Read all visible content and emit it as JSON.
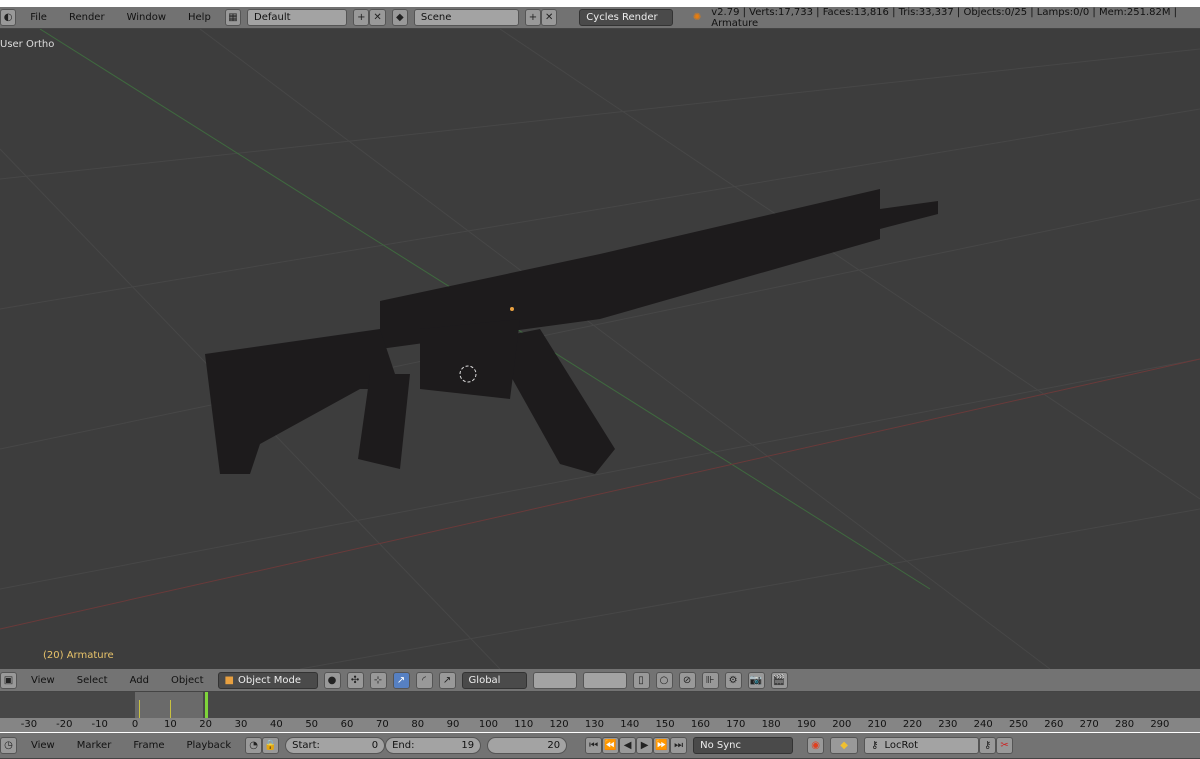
{
  "topbar": {
    "menus": [
      "File",
      "Render",
      "Window",
      "Help"
    ],
    "layout": "Default",
    "scene": "Scene",
    "engine": "Cycles Render",
    "stats": "v2.79 | Verts:17,733 | Faces:13,816 | Tris:33,337 | Objects:0/25 | Lamps:0/0 | Mem:251.82M | Armature"
  },
  "viewport": {
    "view_label": "User Ortho",
    "object_label": "(20) Armature"
  },
  "header3d": {
    "menus": [
      "View",
      "Select",
      "Add",
      "Object"
    ],
    "mode": "Object Mode",
    "orientation": "Global"
  },
  "timeline": {
    "ticks": [
      "-30",
      "-20",
      "-10",
      "0",
      "10",
      "20",
      "30",
      "40",
      "50",
      "60",
      "70",
      "80",
      "90",
      "100",
      "110",
      "120",
      "130",
      "140",
      "150",
      "160",
      "170",
      "180",
      "190",
      "200",
      "210",
      "220",
      "230",
      "240",
      "250",
      "260",
      "270",
      "280",
      "290"
    ],
    "current_frame_value": 20,
    "keyframes": [
      1,
      10
    ],
    "menus": [
      "View",
      "Marker",
      "Frame",
      "Playback"
    ],
    "start_label": "Start:",
    "start": "0",
    "end_label": "End:",
    "end": "19",
    "current": "20",
    "sync": "No Sync",
    "keying_set": "LocRot"
  },
  "colors": {
    "viewport_bg": "#3d3d3d",
    "accent": "#5680c2",
    "current_frame": "#7fd43a",
    "object_label": "#e8c36a"
  }
}
